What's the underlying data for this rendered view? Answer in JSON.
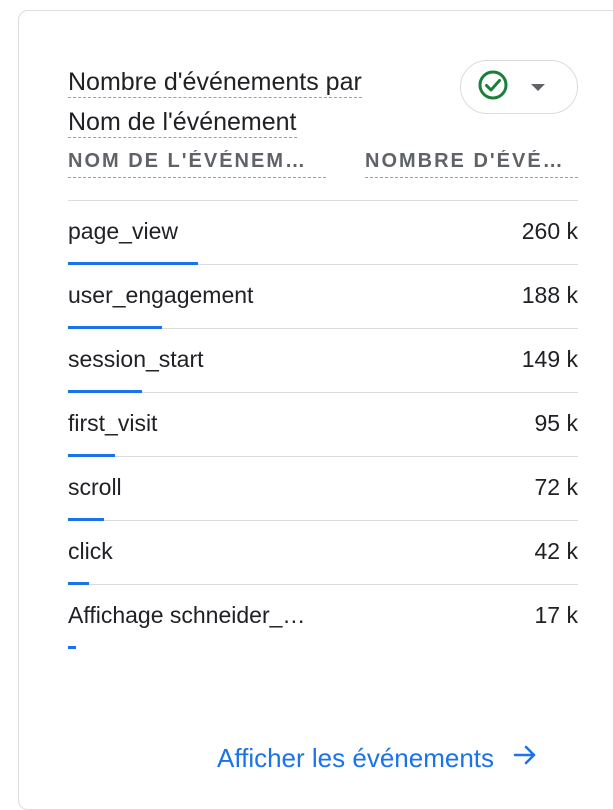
{
  "card": {
    "title_line1": "Nombre d'événements par",
    "title_line2": "Nom de l'événement",
    "status_icon": "check-circle-icon",
    "status_color": "#188038",
    "accent_color": "#1a73e8"
  },
  "table": {
    "col_name": "NOM DE L'ÉVÉNEM…",
    "col_count": "NOMBRE D'ÉVÉ…",
    "rows": [
      {
        "name": "page_view",
        "value": "260 k",
        "share": 1.0
      },
      {
        "name": "user_engagement",
        "value": "188 k",
        "share": 0.723
      },
      {
        "name": "session_start",
        "value": "149 k",
        "share": 0.573
      },
      {
        "name": "first_visit",
        "value": "95 k",
        "share": 0.365
      },
      {
        "name": "scroll",
        "value": "72 k",
        "share": 0.277
      },
      {
        "name": "click",
        "value": "42 k",
        "share": 0.162
      },
      {
        "name": "Affichage schneider_…",
        "value": "17 k",
        "share": 0.065
      }
    ]
  },
  "footer": {
    "link_label": "Afficher les événements",
    "link_icon": "arrow-right-icon"
  }
}
